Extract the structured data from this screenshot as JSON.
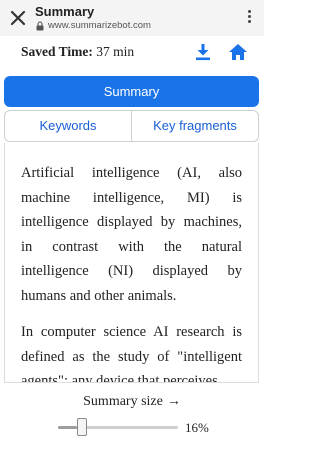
{
  "browser": {
    "title": "Summary",
    "url": "www.summarizebot.com",
    "icons": {
      "close": "close-icon",
      "lock": "lock-icon",
      "menu": "more-vert-icon"
    }
  },
  "info": {
    "saved_label": "Saved Time:",
    "saved_value": "37 min",
    "icons": {
      "download": "download-icon",
      "home": "home-icon"
    },
    "accent_color": "#1a73e8"
  },
  "summary_button": {
    "label": "Summary"
  },
  "tabs": [
    {
      "label": "Keywords"
    },
    {
      "label": "Key fragments"
    }
  ],
  "article": {
    "paragraphs": [
      "Artificial intelligence (AI, also machine intelligence, MI) is intelligence displayed by machines, in contrast with the natural intelligence (NI) displayed by humans and other animals.",
      "In computer science AI research is defined as the study of \"intelligent agents\": any device that perceives"
    ]
  },
  "summary_size": {
    "label": "Summary size",
    "arrow": "→",
    "value_text": "16%",
    "value": 0.16
  }
}
